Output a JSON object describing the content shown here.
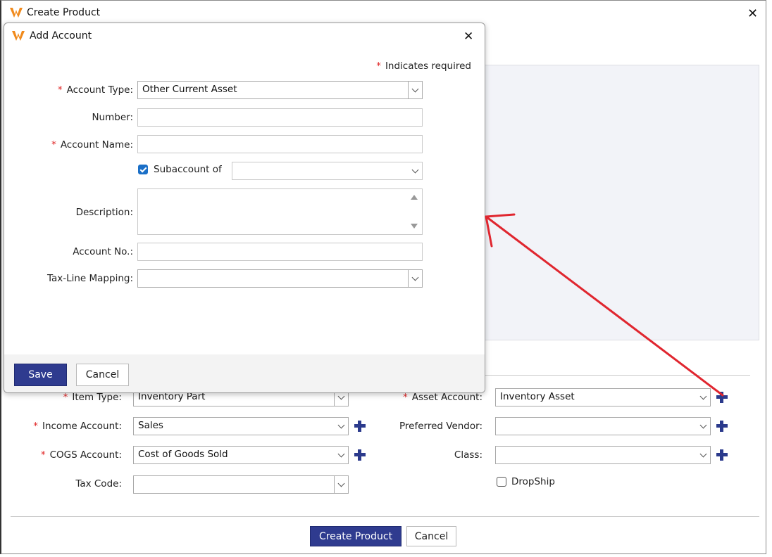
{
  "main_window": {
    "title": "Create Product",
    "fields": {
      "item_type": {
        "label": "Item Type:",
        "value": "Inventory Part",
        "required": "*"
      },
      "income_account": {
        "label": "Income Account:",
        "value": "Sales",
        "required": "*"
      },
      "cogs_account": {
        "label": "COGS Account:",
        "value": "Cost of Goods Sold",
        "required": "*"
      },
      "tax_code": {
        "label": "Tax Code:",
        "value": ""
      },
      "asset_account": {
        "label": "Asset Account:",
        "value": "Inventory Asset",
        "required": "*"
      },
      "preferred_vendor": {
        "label": "Preferred Vendor:",
        "value": ""
      },
      "class": {
        "label": "Class:",
        "value": ""
      },
      "dropship": {
        "label": "DropShip",
        "checked": false
      }
    },
    "buttons": {
      "create": "Create Product",
      "cancel": "Cancel"
    }
  },
  "modal": {
    "title": "Add Account",
    "required_note": "Indicates required",
    "required_mark": "*",
    "fields": {
      "account_type": {
        "label": "Account Type:",
        "value": "Other Current Asset"
      },
      "number": {
        "label": "Number:",
        "value": ""
      },
      "account_name": {
        "label": "Account Name:",
        "value": ""
      },
      "subaccount": {
        "label": "Subaccount of",
        "checked": true,
        "value": ""
      },
      "description": {
        "label": "Description:",
        "value": ""
      },
      "account_no": {
        "label": "Account No.:",
        "value": ""
      },
      "tax_line": {
        "label": "Tax-Line Mapping:",
        "value": ""
      }
    },
    "buttons": {
      "save": "Save",
      "cancel": "Cancel"
    }
  },
  "colors": {
    "accent": "#2f3b8f",
    "annotation_arrow": "#e0262f",
    "required": "#e02424",
    "logo": "#f08a1c"
  }
}
